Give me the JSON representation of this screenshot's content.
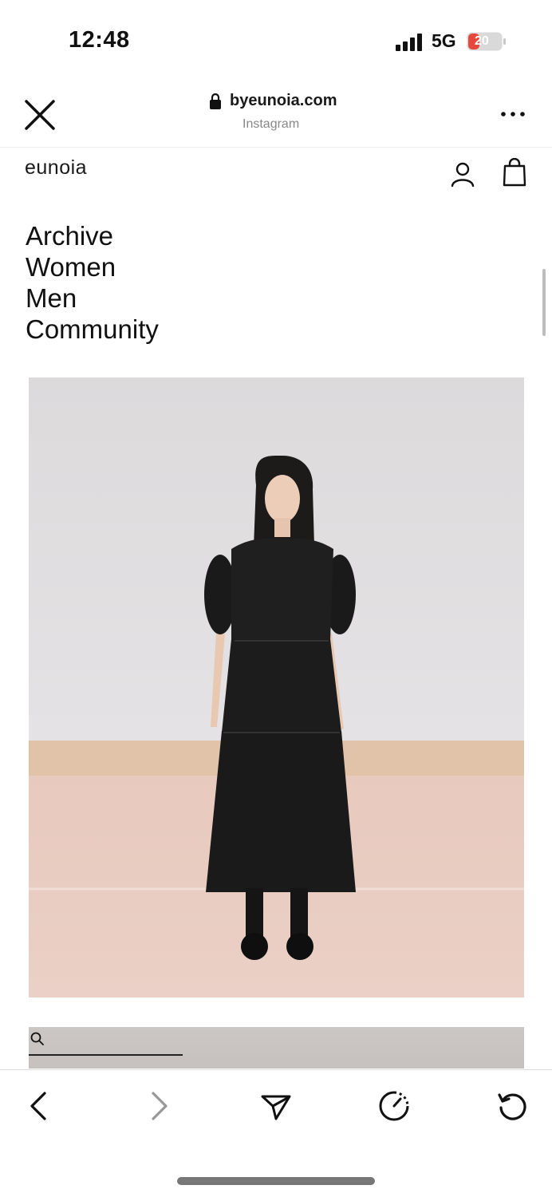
{
  "status_bar": {
    "time": "12:48",
    "network": "5G",
    "battery": "20",
    "battery_color": "#e5483d"
  },
  "browser": {
    "url": "byeunoia.com",
    "source": "Instagram",
    "icons": [
      "close-icon",
      "lock-icon",
      "more-icon"
    ]
  },
  "site": {
    "brand": "eunoia",
    "header_icons": [
      "account-icon",
      "shopping-bag-icon"
    ],
    "nav": [
      "Archive",
      "Women",
      "Men",
      "Community"
    ]
  },
  "content": {
    "photo": "model-in-black-tiered-dress",
    "search_icon": "search-icon"
  },
  "toolbar": {
    "items": [
      "back-icon",
      "forward-icon",
      "share-icon",
      "speed-icon",
      "reload-icon"
    ]
  }
}
